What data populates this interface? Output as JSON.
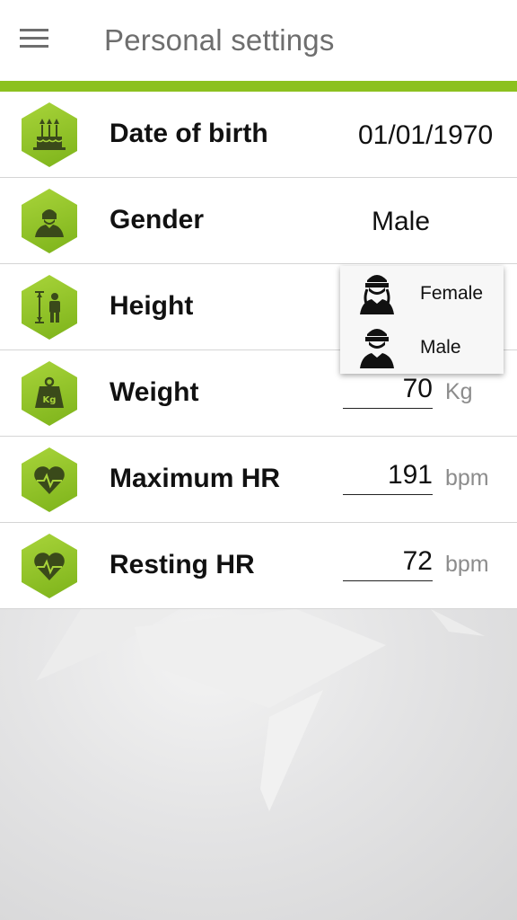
{
  "header": {
    "title": "Personal settings",
    "menu_icon": "hamburger-menu-icon"
  },
  "colors": {
    "accent": "#8cc11f",
    "hex_icon": "#93c428"
  },
  "settings": {
    "date_of_birth": {
      "label": "Date of birth",
      "value": "01/01/1970",
      "icon": "birthday-cake-icon"
    },
    "gender": {
      "label": "Gender",
      "value": "Male",
      "icon": "cyclist-avatar-icon"
    },
    "height": {
      "label": "Height",
      "icon": "height-measure-icon"
    },
    "weight": {
      "label": "Weight",
      "value": "70",
      "unit": "Kg",
      "icon": "weight-kg-icon"
    },
    "max_hr": {
      "label": "Maximum HR",
      "value": "191",
      "unit": "bpm",
      "icon": "heart-pulse-icon"
    },
    "resting_hr": {
      "label": "Resting HR",
      "value": "72",
      "unit": "bpm",
      "icon": "heart-pulse-icon"
    }
  },
  "gender_dropdown": {
    "options": [
      {
        "label": "Female",
        "icon": "female-cyclist-icon"
      },
      {
        "label": "Male",
        "icon": "male-cyclist-icon"
      }
    ]
  }
}
